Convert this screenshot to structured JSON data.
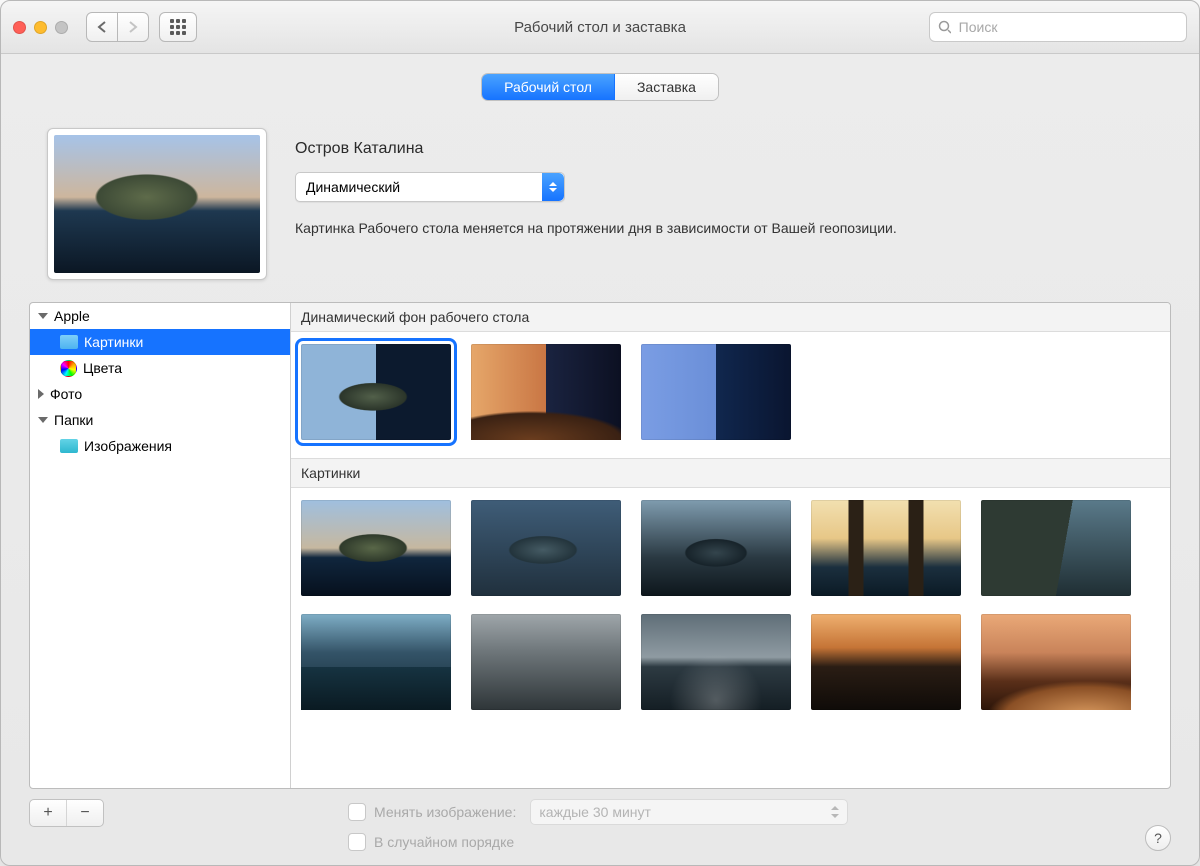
{
  "titlebar": {
    "window_title": "Рабочий стол и заставка",
    "search_placeholder": "Поиск"
  },
  "tabs": {
    "desktop": "Рабочий стол",
    "screensaver": "Заставка"
  },
  "current": {
    "name": "Остров Каталина",
    "mode": "Динамический",
    "description": "Картинка Рабочего стола меняется на протяжении дня в зависимости от Вашей геопозиции."
  },
  "sidebar": [
    {
      "label": "Apple",
      "expanded": true,
      "children": [
        {
          "label": "Картинки",
          "icon": "folder",
          "selected": true
        },
        {
          "label": "Цвета",
          "icon": "colorwheel"
        }
      ]
    },
    {
      "label": "Фото",
      "expanded": false
    },
    {
      "label": "Папки",
      "expanded": true,
      "children": [
        {
          "label": "Изображения",
          "icon": "folder-teal"
        }
      ]
    }
  ],
  "sections": {
    "dynamic_header": "Динамический фон рабочего стола",
    "pictures_header": "Картинки"
  },
  "footer": {
    "change_label": "Менять изображение:",
    "interval": "каждые 30 минут",
    "random_label": "В случайном порядке"
  }
}
